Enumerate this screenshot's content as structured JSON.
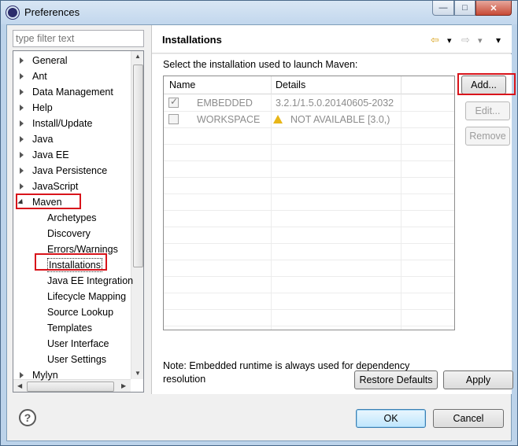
{
  "window": {
    "title": "Preferences",
    "minimize": "—",
    "maximize": "□",
    "close": "✕"
  },
  "filter": {
    "placeholder": "type filter text"
  },
  "tree": [
    {
      "label": "General",
      "level": 0,
      "expander": "collapsed"
    },
    {
      "label": "Ant",
      "level": 0,
      "expander": "collapsed"
    },
    {
      "label": "Data Management",
      "level": 0,
      "expander": "collapsed"
    },
    {
      "label": "Help",
      "level": 0,
      "expander": "collapsed"
    },
    {
      "label": "Install/Update",
      "level": 0,
      "expander": "collapsed"
    },
    {
      "label": "Java",
      "level": 0,
      "expander": "collapsed"
    },
    {
      "label": "Java EE",
      "level": 0,
      "expander": "collapsed"
    },
    {
      "label": "Java Persistence",
      "level": 0,
      "expander": "collapsed"
    },
    {
      "label": "JavaScript",
      "level": 0,
      "expander": "collapsed"
    },
    {
      "label": "Maven",
      "level": 0,
      "expander": "expanded"
    },
    {
      "label": "Archetypes",
      "level": 1
    },
    {
      "label": "Discovery",
      "level": 1
    },
    {
      "label": "Errors/Warnings",
      "level": 1
    },
    {
      "label": "Installations",
      "level": 1,
      "selected": true
    },
    {
      "label": "Java EE Integration",
      "level": 1
    },
    {
      "label": "Lifecycle Mapping",
      "level": 1
    },
    {
      "label": "Source Lookup",
      "level": 1
    },
    {
      "label": "Templates",
      "level": 1
    },
    {
      "label": "User Interface",
      "level": 1
    },
    {
      "label": "User Settings",
      "level": 1
    },
    {
      "label": "Mylyn",
      "level": 0,
      "expander": "collapsed"
    }
  ],
  "page": {
    "title": "Installations",
    "description": "Select the installation used to launch Maven:",
    "columns": {
      "name": "Name",
      "details": "Details"
    },
    "rows": [
      {
        "checked": true,
        "name": "EMBEDDED",
        "details": "3.2.1/1.5.0.20140605-2032",
        "warning": false
      },
      {
        "checked": false,
        "name": "WORKSPACE",
        "details": "NOT AVAILABLE [3.0,)",
        "warning": true
      }
    ],
    "buttons": {
      "add": "Add...",
      "edit": "Edit...",
      "remove": "Remove"
    },
    "note": "Note: Embedded runtime is always used for dependency resolution",
    "restore_defaults": "Restore Defaults",
    "apply": "Apply"
  },
  "nav": {
    "back": "⇦",
    "forward": "⇨",
    "dropdown": "▾",
    "menu": "▾"
  },
  "footer": {
    "help": "?",
    "ok": "OK",
    "cancel": "Cancel"
  },
  "colors": {
    "highlight": "#d8141b",
    "titlebar": "#c2d7ed",
    "dialog_bg": "#f0f0f0"
  }
}
